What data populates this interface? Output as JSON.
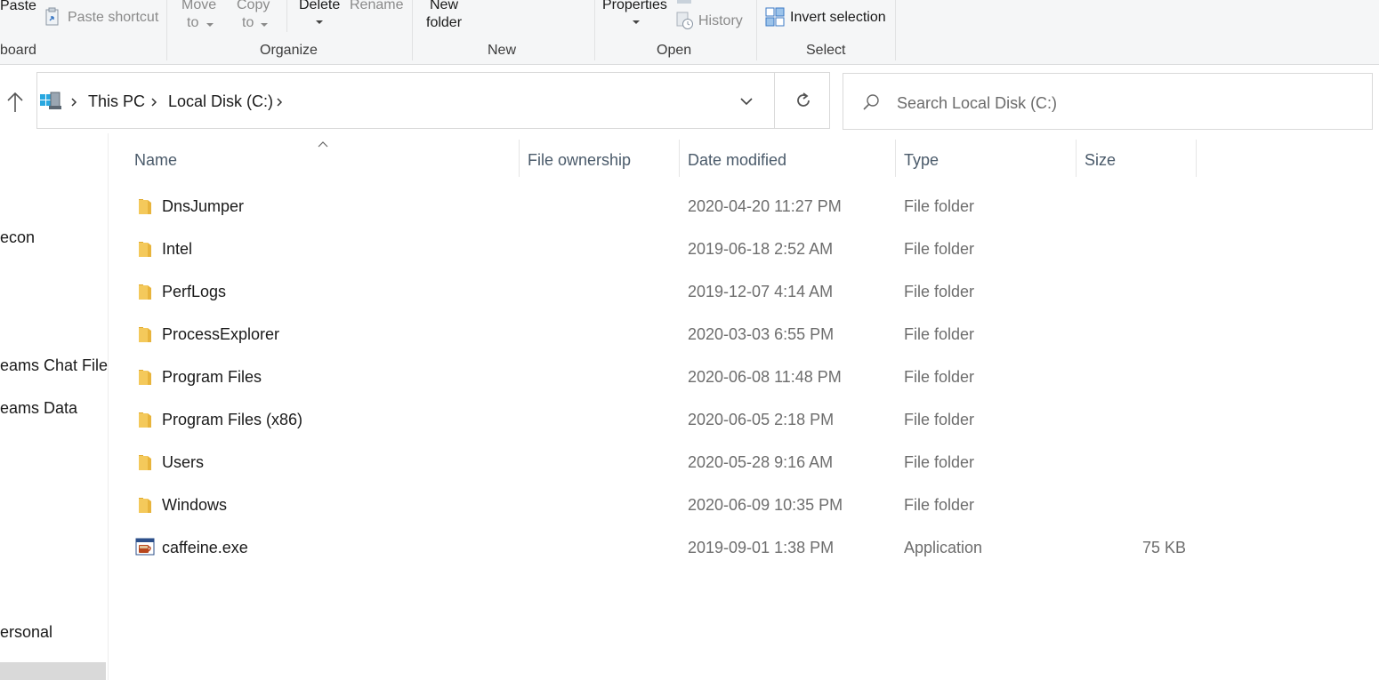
{
  "ribbon": {
    "clipboard": {
      "paste": "Paste",
      "paste_shortcut": "Paste shortcut",
      "group": "board"
    },
    "organize": {
      "move_line1": "Move",
      "move_line2": "to",
      "copy_line1": "Copy",
      "copy_line2": "to",
      "delete": "Delete",
      "rename": "Rename",
      "group": "Organize"
    },
    "new": {
      "new_folder_line1": "New",
      "new_folder_line2": "folder",
      "group": "New"
    },
    "open": {
      "properties": "Properties",
      "history": "History",
      "group": "Open"
    },
    "select": {
      "invert_selection": "Invert selection",
      "group": "Select"
    }
  },
  "address": {
    "crumbs": [
      "This PC",
      "Local Disk (C:)"
    ]
  },
  "search": {
    "placeholder": "Search Local Disk (C:)"
  },
  "nav": {
    "items": [
      "econ",
      "eams Chat Files",
      "eams Data",
      "ersonal"
    ]
  },
  "columns": {
    "name": "Name",
    "ownership": "File ownership",
    "date": "Date modified",
    "type": "Type",
    "size": "Size"
  },
  "files": [
    {
      "name": "DnsJumper",
      "date": "2020-04-20 11:27 PM",
      "type": "File folder",
      "size": "",
      "icon": "folder-icon"
    },
    {
      "name": "Intel",
      "date": "2019-06-18 2:52 AM",
      "type": "File folder",
      "size": "",
      "icon": "folder-icon"
    },
    {
      "name": "PerfLogs",
      "date": "2019-12-07 4:14 AM",
      "type": "File folder",
      "size": "",
      "icon": "folder-icon"
    },
    {
      "name": "ProcessExplorer",
      "date": "2020-03-03 6:55 PM",
      "type": "File folder",
      "size": "",
      "icon": "folder-icon"
    },
    {
      "name": "Program Files",
      "date": "2020-06-08 11:48 PM",
      "type": "File folder",
      "size": "",
      "icon": "folder-icon"
    },
    {
      "name": "Program Files (x86)",
      "date": "2020-06-05 2:18 PM",
      "type": "File folder",
      "size": "",
      "icon": "folder-icon"
    },
    {
      "name": "Users",
      "date": "2020-05-28 9:16 AM",
      "type": "File folder",
      "size": "",
      "icon": "folder-icon"
    },
    {
      "name": "Windows",
      "date": "2020-06-09 10:35 PM",
      "type": "File folder",
      "size": "",
      "icon": "folder-icon"
    },
    {
      "name": "caffeine.exe",
      "date": "2019-09-01 1:38 PM",
      "type": "Application",
      "size": "75 KB",
      "icon": "application-icon"
    }
  ],
  "colors": {
    "ribbon_bg": "#f5f6f7",
    "folder": "#f4c95b",
    "header_text": "#4a5a6a",
    "secondary_text": "#6d6d6d"
  }
}
